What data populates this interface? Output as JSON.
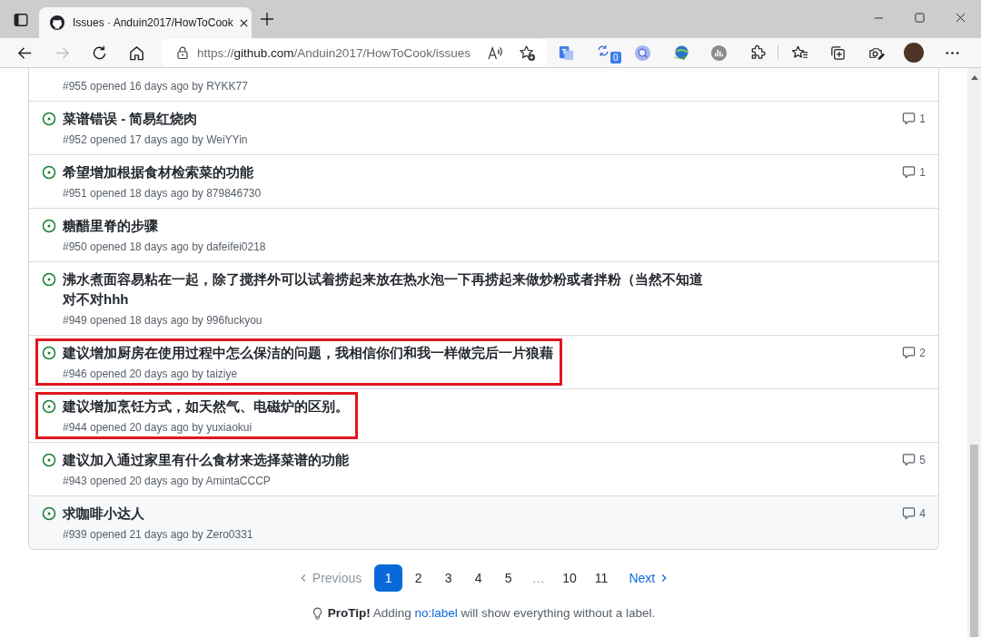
{
  "tabs": [
    {
      "title": "Issues · Anduin2017/HowToCook",
      "selected": true
    }
  ],
  "toolbar": {
    "nav": [
      {
        "kind": "back",
        "disabled": false
      },
      {
        "kind": "forward",
        "disabled": true
      },
      {
        "kind": "refresh",
        "disabled": false
      },
      {
        "kind": "home",
        "disabled": false
      }
    ],
    "address": {
      "scheme": "https://",
      "host": "github.com",
      "path": "/Anduin2017/HowToCook/issues"
    },
    "sync_badge": "0"
  },
  "issues": [
    {
      "meta": "#955 opened 16 days ago by RYKK77",
      "highlighted": false,
      "hovered": false
    },
    {
      "title": "菜谱错误 - 简易红烧肉",
      "meta": "#952 opened 17 days ago by WeiYYin",
      "comments": "1",
      "highlighted": false,
      "hovered": false
    },
    {
      "title": "希望增加根据食材检索菜的功能",
      "meta": "#951 opened 18 days ago by 879846730",
      "comments": "1",
      "highlighted": false,
      "hovered": false
    },
    {
      "title": "糖醋里脊的步骤",
      "meta": "#950 opened 18 days ago by dafeifei0218",
      "highlighted": false,
      "hovered": false
    },
    {
      "title": "沸水煮面容易粘在一起，除了搅拌外可以试着捞起来放在热水泡一下再捞起来做炒粉或者拌粉（当然不知道对不对hhh",
      "meta": "#949 opened 18 days ago by 996fuckyou",
      "highlighted": false,
      "hovered": false
    },
    {
      "title": "建议增加厨房在使用过程中怎么保洁的问题，我相信你们和我一样做完后一片狼藉",
      "meta": "#946 opened 20 days ago by taiziye",
      "comments": "2",
      "highlighted": true,
      "hovered": false
    },
    {
      "title": "建议增加烹饪方式，如天然气、电磁炉的区别。",
      "meta": "#944 opened 20 days ago by yuxiaokui",
      "highlighted": true,
      "hovered": false
    },
    {
      "title": "建议加入通过家里有什么食材来选择菜谱的功能",
      "meta": "#943 opened 20 days ago by AmintaCCCP",
      "comments": "5",
      "highlighted": false,
      "hovered": false
    },
    {
      "title": "求咖啡小达人",
      "meta": "#939 opened 21 days ago by Zero0331",
      "comments": "4",
      "highlighted": false,
      "hovered": true
    }
  ],
  "pagination": {
    "previous": {
      "label": "Previous",
      "disabled": true
    },
    "pages": [
      {
        "kind": "page",
        "label": "1",
        "selected": true
      },
      {
        "kind": "page",
        "label": "2",
        "selected": false
      },
      {
        "kind": "page",
        "label": "3",
        "selected": false
      },
      {
        "kind": "page",
        "label": "4",
        "selected": false
      },
      {
        "kind": "page",
        "label": "5",
        "selected": false
      },
      {
        "kind": "gap",
        "label": "…"
      },
      {
        "kind": "page",
        "label": "10",
        "selected": false
      },
      {
        "kind": "page",
        "label": "11",
        "selected": false
      }
    ],
    "next": {
      "label": "Next",
      "disabled": false
    }
  },
  "protip": {
    "text": "**ProTip!** Adding ",
    "link": "no:label",
    "text_after": " will show everything without a label."
  }
}
